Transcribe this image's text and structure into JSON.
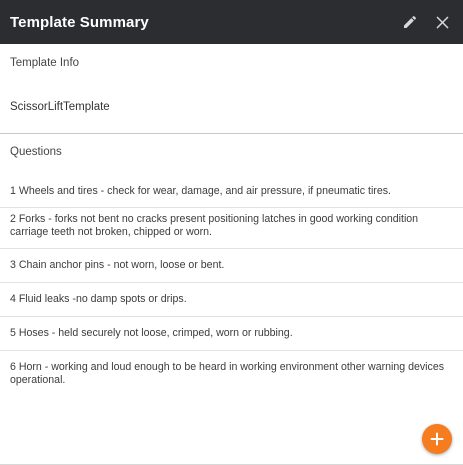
{
  "dialog": {
    "title": "Template Summary",
    "edit_icon": "pencil-icon",
    "close_icon": "close-icon",
    "header_bg": "#2b2d30"
  },
  "template_info": {
    "label": "Template Info",
    "name": "ScissorLiftTemplate"
  },
  "questions": {
    "label": "Questions",
    "items": [
      "1 Wheels and tires - check for wear, damage, and air pressure, if pneumatic tires.",
      "2 Forks - forks not bent no cracks present positioning latches in good working condition carriage teeth not broken, chipped or worn.",
      "3 Chain anchor pins - not worn, loose or bent.",
      "4 Fluid leaks -no damp spots or drips.",
      "5 Hoses - held securely not loose, crimped, worn or rubbing.",
      "6 Horn - working and loud enough to be heard in working environment other warning devices operational."
    ]
  },
  "fab": {
    "icon": "plus-icon",
    "color": "#f57c1f"
  }
}
